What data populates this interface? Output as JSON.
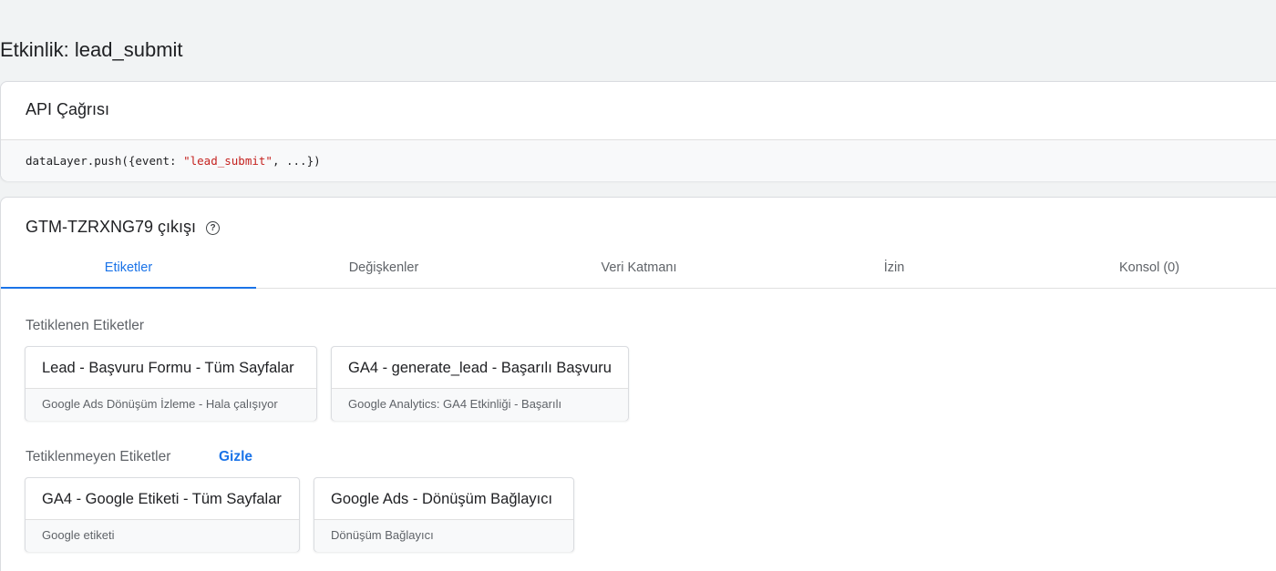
{
  "page": {
    "title": "Etkinlik: lead_submit"
  },
  "api_call": {
    "title": "API Çağrısı",
    "code_prefix": "dataLayer.push({event: ",
    "code_string": "\"lead_submit\"",
    "code_suffix": ", ...})"
  },
  "output": {
    "title": "GTM-TZRXNG79 çıkışı",
    "help_icon": "help-circle-icon",
    "tabs": [
      {
        "label": "Etiketler",
        "active": true
      },
      {
        "label": "Değişkenler",
        "active": false
      },
      {
        "label": "Veri Katmanı",
        "active": false
      },
      {
        "label": "İzin",
        "active": false
      },
      {
        "label": "Konsol (0)",
        "active": false
      }
    ],
    "fired": {
      "label": "Tetiklenen Etiketler",
      "tags": [
        {
          "name": "Lead - Başvuru Formu - Tüm Sayfalar",
          "detail": "Google Ads Dönüşüm İzleme - Hala çalışıyor"
        },
        {
          "name": "GA4 - generate_lead - Başarılı Başvuru",
          "detail": "Google Analytics: GA4 Etkinliği - Başarılı"
        }
      ]
    },
    "not_fired": {
      "label": "Tetiklenmeyen Etiketler",
      "hide_label": "Gizle",
      "tags": [
        {
          "name": "GA4 - Google Etiketi - Tüm Sayfalar",
          "detail": "Google etiketi"
        },
        {
          "name": "Google Ads - Dönüşüm Bağlayıcı",
          "detail": "Dönüşüm Bağlayıcı"
        }
      ]
    }
  },
  "colors": {
    "accent": "#1a73e8",
    "code_string": "#c5221f",
    "background": "#f1f3f4"
  }
}
